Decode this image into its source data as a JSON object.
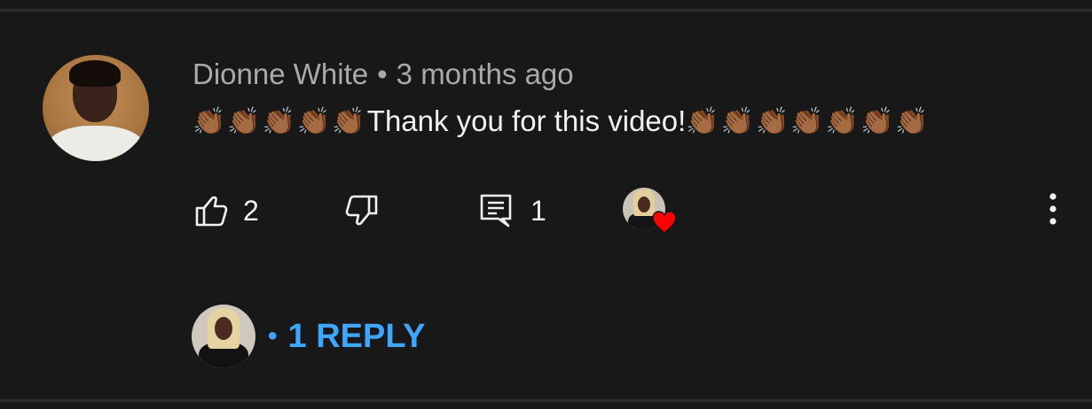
{
  "comment": {
    "author": "Dionne White",
    "separator": "•",
    "time": "3 months ago",
    "clap_prefix": "👏🏾👏🏾👏🏾👏🏾👏🏾",
    "text": "Thank you for this video!",
    "clap_suffix": "👏🏾👏🏾👏🏾👏🏾👏🏾👏🏾👏🏾",
    "emoji_name": "clapping-hands-medium-dark-skin",
    "avatar_icon": "user-avatar-photo"
  },
  "actions": {
    "like_icon": "thumbs-up-icon",
    "like_count": "2",
    "dislike_icon": "thumbs-down-icon",
    "reply_icon": "comment-icon",
    "reply_count": "1",
    "hearted_by_creator": true,
    "heart_color": "#ff0000",
    "menu_icon": "more-vertical-icon"
  },
  "replies": {
    "dot": "•",
    "label": "1 REPLY",
    "link_color": "#3ea6ff"
  },
  "colors": {
    "background": "#181818",
    "primary_text": "#f1f1f1",
    "secondary_text": "#aaaaaa",
    "divider": "#2c2c2c"
  }
}
